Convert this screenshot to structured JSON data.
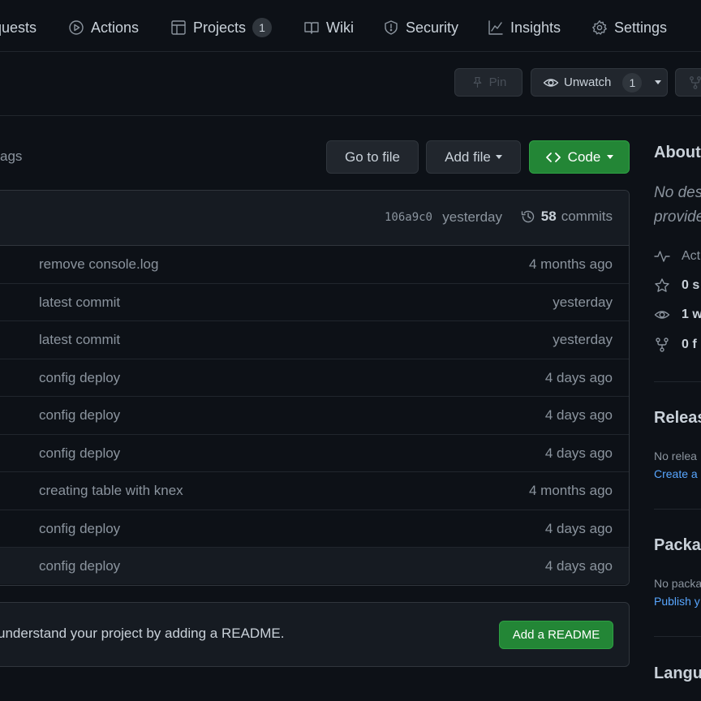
{
  "nav": {
    "items": [
      {
        "label": "quests",
        "icon": "pull-request-icon"
      },
      {
        "label": "Actions",
        "icon": "play-icon"
      },
      {
        "label": "Projects",
        "icon": "table-icon",
        "count": "1"
      },
      {
        "label": "Wiki",
        "icon": "book-icon"
      },
      {
        "label": "Security",
        "icon": "shield-icon"
      },
      {
        "label": "Insights",
        "icon": "graph-icon"
      },
      {
        "label": "Settings",
        "icon": "gear-icon"
      }
    ]
  },
  "actions": {
    "pin_label": "Pin",
    "unwatch_label": "Unwatch",
    "watch_count": "1"
  },
  "branch_bar": {
    "tags_tail": "ags",
    "go_to_file": "Go to file",
    "add_file": "Add file",
    "code": "Code"
  },
  "latest_commit": {
    "sha": "106a9c0",
    "when": "yesterday",
    "commit_count": "58",
    "commits_label": "commits"
  },
  "files": [
    {
      "message": "remove console.log",
      "age": "4 months ago"
    },
    {
      "message": "latest commit",
      "age": "yesterday"
    },
    {
      "message": "latest commit",
      "age": "yesterday"
    },
    {
      "message": "config deploy",
      "age": "4 days ago"
    },
    {
      "message": "config deploy",
      "age": "4 days ago"
    },
    {
      "message": "config deploy",
      "age": "4 days ago"
    },
    {
      "message": "creating table with knex",
      "age": "4 months ago"
    },
    {
      "message": "config deploy",
      "age": "4 days ago"
    },
    {
      "message": "config deploy",
      "age": "4 days ago"
    }
  ],
  "readme": {
    "text": "understand your project by adding a README.",
    "button": "Add a README"
  },
  "sidebar": {
    "about_title": "About",
    "description_line1": "No des",
    "description_line2": "provide",
    "activity": "Act",
    "stars": "0 s",
    "watchers": "1 w",
    "forks": "0 f",
    "releases_title": "Releas",
    "releases_note": "No relea",
    "releases_link": "Create a",
    "packages_title": "Packa",
    "packages_note": "No packa",
    "packages_link": "Publish y",
    "languages_title": "Langu"
  },
  "colors": {
    "background": "#0d1117",
    "accent_green": "#238636",
    "link_blue": "#58a6ff",
    "muted_text": "#8b949e"
  }
}
